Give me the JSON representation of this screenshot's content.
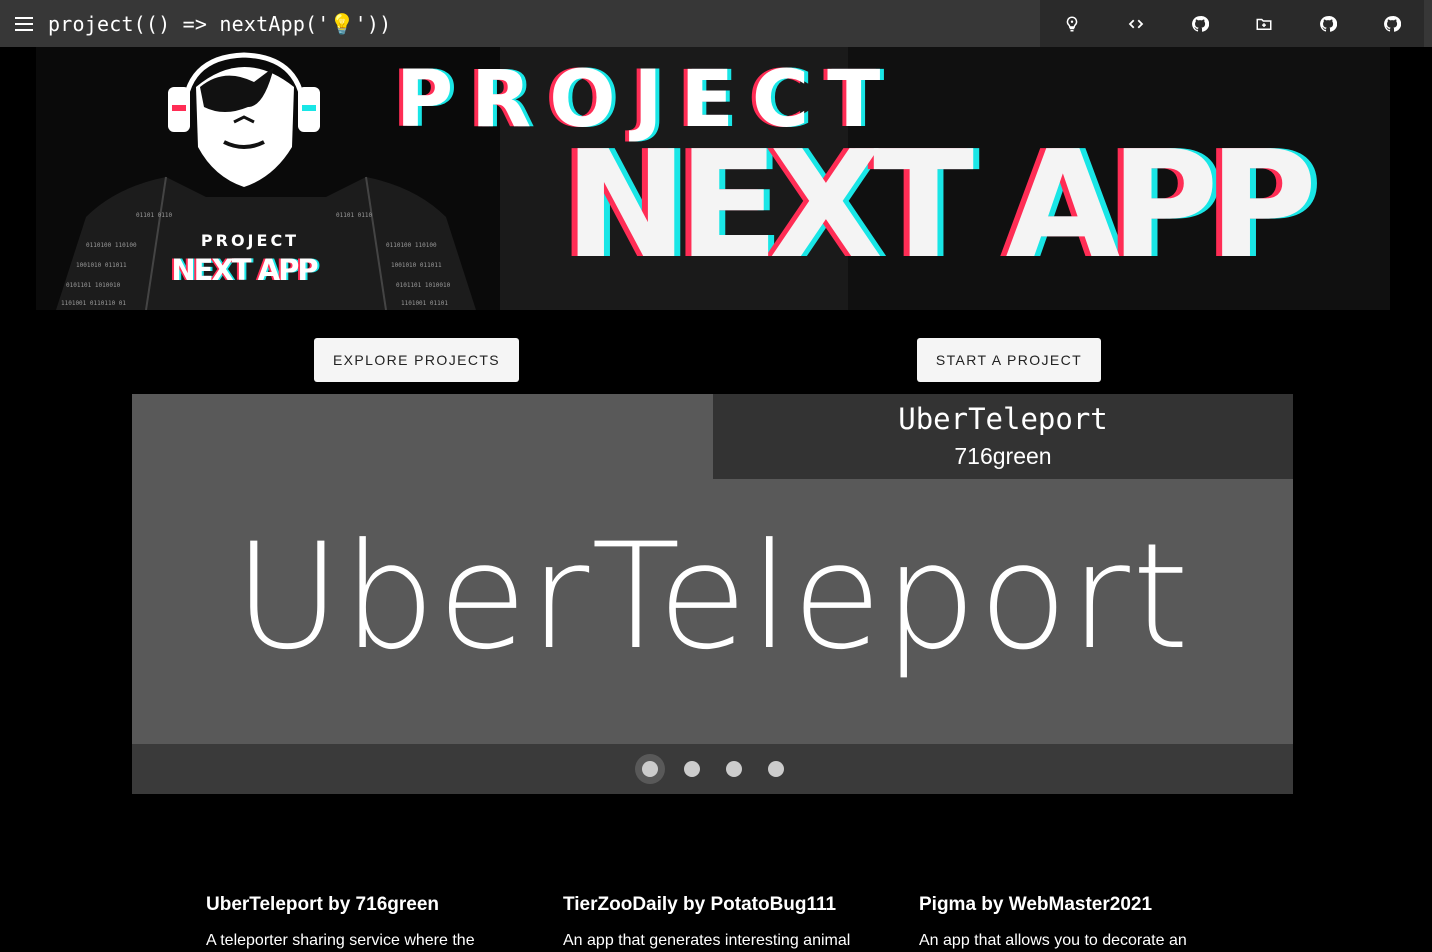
{
  "appbar": {
    "title": "project(() => nextApp('💡'))",
    "icons": [
      "lightbulb-icon",
      "code-icon",
      "github-icon",
      "new-folder-icon",
      "github-icon",
      "github-icon"
    ]
  },
  "banner": {
    "mini_logo_top": "PROJECT",
    "mini_logo_bottom": "NEXT APP",
    "big_top": "PROJECT",
    "big_bottom": "NEXT APP"
  },
  "actions": {
    "explore_label": "EXPLORE PROJECTS",
    "start_label": "START A PROJECT"
  },
  "carousel": {
    "caption_title": "UberTeleport",
    "caption_author": "716green",
    "slide_heading": "UberTeleport",
    "dot_count": 4,
    "active_index": 0
  },
  "cards": [
    {
      "title": "UberTeleport by 716green",
      "description": "A teleporter sharing service where the"
    },
    {
      "title": "TierZooDaily by PotatoBug111",
      "description": "An app that generates interesting animal"
    },
    {
      "title": "Pigma by WebMaster2021",
      "description": "An app that allows you to decorate an"
    }
  ],
  "colors": {
    "appbar": "#373737",
    "accent_red": "#ff2d55",
    "accent_cyan": "#19e6e6",
    "carousel_bg": "#595959"
  }
}
